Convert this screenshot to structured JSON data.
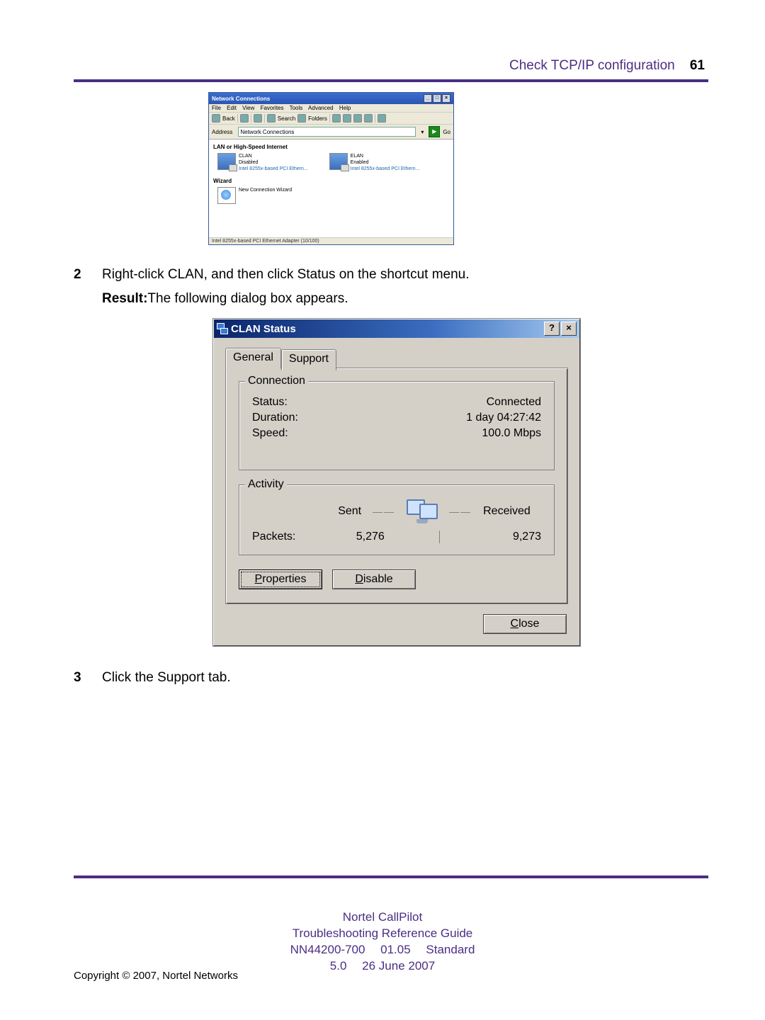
{
  "header": {
    "title": "Check TCP/IP configuration",
    "page_num": "61"
  },
  "nc": {
    "window_title": "Network Connections",
    "menus": [
      "File",
      "Edit",
      "View",
      "Favorites",
      "Tools",
      "Advanced",
      "Help"
    ],
    "toolbar": {
      "back": "Back",
      "search": "Search",
      "folders": "Folders"
    },
    "addr_label": "Address",
    "addr_value": "Network Connections",
    "go": "Go",
    "section_lan": "LAN or High-Speed Internet",
    "clan": {
      "name": "CLAN",
      "state": "Disabled",
      "detail": "Intel 8255x-based PCI Ethern..."
    },
    "elan": {
      "name": "ELAN",
      "state": "Enabled",
      "detail": "Intel 8255x-based PCI Ethern..."
    },
    "section_wizard": "Wizard",
    "wizard_item": "New Connection Wizard",
    "status_bar": "Intel 8255x-based PCI Ethernet Adapter (10/100)"
  },
  "steps": {
    "s2_num": "2",
    "s2_text": "Right-click CLAN, and then click Status on the shortcut menu.",
    "s2_result_label": "Result:",
    "s2_result_text": "The following dialog box appears.",
    "s3_num": "3",
    "s3_text": "Click the Support tab."
  },
  "dlg": {
    "title": "CLAN Status",
    "help": "?",
    "close_x": "×",
    "tabs": {
      "general": "General",
      "support": "Support"
    },
    "connection": {
      "legend": "Connection",
      "status_label": "Status:",
      "status_value": "Connected",
      "duration_label": "Duration:",
      "duration_value": "1 day 04:27:42",
      "speed_label": "Speed:",
      "speed_value": "100.0 Mbps"
    },
    "activity": {
      "legend": "Activity",
      "sent_label": "Sent",
      "recv_label": "Received",
      "packets_label": "Packets:",
      "sent_value": "5,276",
      "recv_value": "9,273"
    },
    "buttons": {
      "properties_u": "P",
      "properties": "roperties",
      "disable_u": "D",
      "disable": "isable",
      "close_u": "C",
      "close": "lose"
    }
  },
  "footer": {
    "l1": "Nortel CallPilot",
    "l2": "Troubleshooting Reference Guide",
    "l3": "NN44200-700  01.05  Standard",
    "l4": "5.0  26 June 2007"
  },
  "copyright": "Copyright © 2007, Nortel Networks"
}
